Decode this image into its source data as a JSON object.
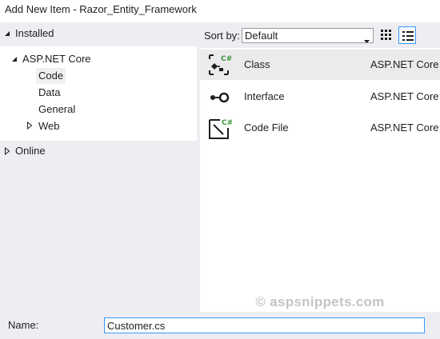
{
  "window": {
    "title": "Add New Item - Razor_Entity_Framework"
  },
  "left_panel": {
    "installed_label": "Installed",
    "tree": {
      "root_label": "ASP.NET Core",
      "children": [
        "Code",
        "Data",
        "General",
        "Web"
      ],
      "selected": "Code"
    },
    "online_label": "Online"
  },
  "toolbar": {
    "sort_by_label": "Sort by:",
    "sort_value": "Default",
    "view_icons": [
      "small-icons-view-icon",
      "list-view-icon"
    ],
    "active_view": "list-view-icon"
  },
  "templates": [
    {
      "name": "Class",
      "category": "ASP.NET Core",
      "icon": "class-icon",
      "selected": true
    },
    {
      "name": "Interface",
      "category": "ASP.NET Core",
      "icon": "interface-icon",
      "selected": false
    },
    {
      "name": "Code File",
      "category": "ASP.NET Core",
      "icon": "code-file-icon",
      "selected": false
    }
  ],
  "watermark": "© aspsnippets.com",
  "name_field": {
    "label": "Name:",
    "value": "Customer.cs"
  },
  "colors": {
    "panel_bg": "#eeeef2",
    "selection_bg": "#ebebee",
    "focus_border": "#3399ff",
    "csharp_badge": "#3c9a3c"
  }
}
